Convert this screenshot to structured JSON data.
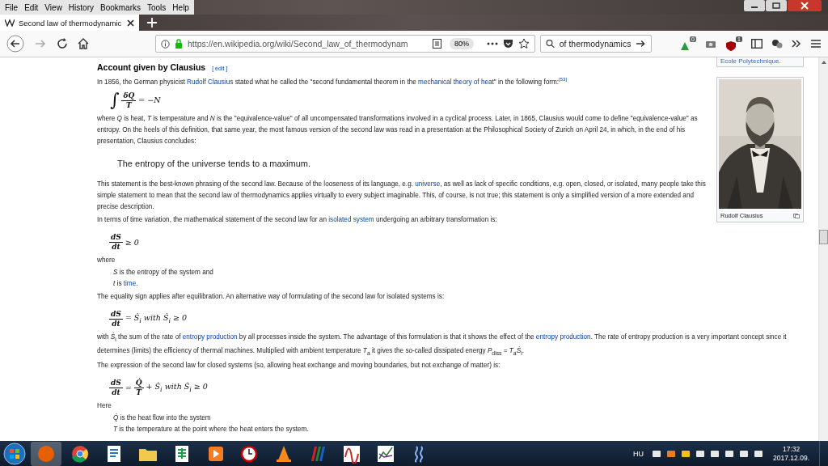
{
  "menu_bar": [
    {
      "label": "File"
    },
    {
      "label": "Edit"
    },
    {
      "label": "View"
    },
    {
      "label": "History"
    },
    {
      "label": "Bookmarks"
    },
    {
      "label": "Tools"
    },
    {
      "label": "Help"
    }
  ],
  "tab": {
    "title": "Second law of thermodynamic",
    "selected": true
  },
  "toolbar": {
    "url": "https://en.wikipedia.org/wiki/Second_law_of_thermodynam",
    "zoom": "80%",
    "search": {
      "value": "of thermodynamics"
    },
    "badges": [
      "0",
      "1"
    ]
  },
  "infobox": {
    "previous_caption": "Ecole Polytechnique.",
    "caption": "Rudolf Clausius"
  },
  "article": {
    "blocks": [
      {
        "kind": "heading",
        "text": "Account given by Clausius",
        "edit": "[ edit ]"
      },
      {
        "kind": "para",
        "segments": [
          {
            "kind": "text",
            "text": "In 1856, the German physicist "
          },
          {
            "kind": "link",
            "text": "Rudolf Clausius"
          },
          {
            "kind": "text",
            "text": " stated what he called the \"second fundamental theorem in the "
          },
          {
            "kind": "link",
            "text": "mechanical theory of heat"
          },
          {
            "kind": "text",
            "text": "\" in the following form:"
          },
          {
            "kind": "ref",
            "text": "[53]"
          }
        ]
      },
      {
        "kind": "math",
        "parts": [
          {
            "kind": "text",
            "text": "∫"
          },
          {
            "kind": "frac",
            "num": "δQ",
            "den": "T"
          },
          {
            "kind": "text",
            "text": "= −N"
          }
        ]
      },
      {
        "kind": "para",
        "segments": [
          {
            "kind": "text",
            "text": "where *Q* is heat, *T* is temperature and *N* is the \"equivalence-value\" of all uncompensated transformations involved in a cyclical process. Later, in 1865, Clausius would come to define \"equivalence-value\" as entropy. On the heels of this definition, that same year, the most famous version of the second law was read in a presentation at the Philosophical Society of Zurich on April 24, in which, in the end of his presentation, Clausius concludes:"
          }
        ]
      },
      {
        "kind": "quote",
        "text": "The entropy of the universe tends to a maximum."
      },
      {
        "kind": "para",
        "segments": [
          {
            "kind": "text",
            "text": "This statement is the best-known phrasing of the second law. Because of the looseness of its language, e.g. "
          },
          {
            "kind": "link",
            "text": "universe"
          },
          {
            "kind": "text",
            "text": ", as well as lack of specific conditions, e.g. open, closed, or isolated, many people take this simple statement to mean that the second law of thermodynamics applies virtually to every subject imaginable. This, of course, is not true; this statement is only a simplified version of a more extended and precise description."
          }
        ]
      },
      {
        "kind": "para",
        "segments": [
          {
            "kind": "text",
            "text": "In terms of time variation, the mathematical statement of the second law for an "
          },
          {
            "kind": "link",
            "text": "isolated system"
          },
          {
            "kind": "text",
            "text": " undergoing an arbitrary transformation is:"
          }
        ]
      },
      {
        "kind": "math",
        "parts": [
          {
            "kind": "frac",
            "num": "dS",
            "den": "dt"
          },
          {
            "kind": "text",
            "text": "≥ 0"
          }
        ]
      },
      {
        "kind": "para",
        "segments": [
          {
            "kind": "text",
            "text": "where"
          }
        ]
      },
      {
        "kind": "item",
        "segments": [
          {
            "kind": "text",
            "text": "*S* is the entropy of the system and"
          }
        ]
      },
      {
        "kind": "item",
        "segments": [
          {
            "kind": "text",
            "text": "*t* is "
          },
          {
            "kind": "link",
            "text": "time"
          },
          {
            "kind": "text",
            "text": "."
          }
        ]
      },
      {
        "kind": "para",
        "segments": [
          {
            "kind": "text",
            "text": "The equality sign applies after equilibration. An alternative way of formulating of the second law for isolated systems is:"
          }
        ]
      },
      {
        "kind": "math",
        "parts": [
          {
            "kind": "frac",
            "num": "dS",
            "den": "dt"
          },
          {
            "kind": "text",
            "text": "= Ṡ$_{i}$ with Ṡ$_{i}$ ≥ 0"
          }
        ]
      },
      {
        "kind": "para",
        "segments": [
          {
            "kind": "text",
            "text": "with *Ṡ*$_{i}$ the sum of the rate of "
          },
          {
            "kind": "link",
            "text": "entropy production"
          },
          {
            "kind": "text",
            "text": " by all processes inside the system. The advantage of this formulation is that it shows the effect of the "
          },
          {
            "kind": "link",
            "text": "entropy production"
          },
          {
            "kind": "text",
            "text": ". The rate of entropy production is a very important concept since it determines (limits) the efficiency of thermal machines. Multiplied with ambient temperature *T*$_{a}$ it gives the so-called dissipated energy *P*$_{diss}$ = *T*$_{a}$*Ṡ*$_{i}$."
          }
        ]
      },
      {
        "kind": "para",
        "segments": [
          {
            "kind": "text",
            "text": "The expression of the second law for closed systems (so, allowing heat exchange and moving boundaries, but not exchange of matter) is:"
          }
        ]
      },
      {
        "kind": "math",
        "parts": [
          {
            "kind": "frac",
            "num": "dS",
            "den": "dt"
          },
          {
            "kind": "text",
            "text": "="
          },
          {
            "kind": "frac",
            "num": "Q̇",
            "den": "T"
          },
          {
            "kind": "text",
            "text": "+ Ṡ$_{i}$ with Ṡ$_{i}$ ≥ 0"
          }
        ]
      },
      {
        "kind": "para",
        "segments": [
          {
            "kind": "text",
            "text": "Here"
          }
        ]
      },
      {
        "kind": "item",
        "segments": [
          {
            "kind": "text",
            "text": "*Q̇* is the heat flow into the system"
          }
        ]
      },
      {
        "kind": "item",
        "segments": [
          {
            "kind": "text",
            "text": "*T* is the temperature at the point where the heat enters the system."
          }
        ]
      }
    ]
  },
  "taskbar": {
    "language": "HU",
    "time": "17:32",
    "date": "2017.12.09."
  }
}
